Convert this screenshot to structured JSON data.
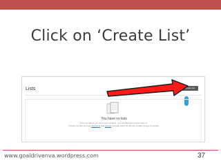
{
  "slide": {
    "title": "Click on ‘Create List’",
    "footer_url": "www.goaldrivenva.wordpress.com",
    "page_number": "37",
    "accent_color": "#c0504d"
  },
  "screenshot": {
    "heading": "Lists",
    "create_button_label": "Create List",
    "empty_state": {
      "title": "You have no lists",
      "line1": "Lists are where you store your contacts, you can filter/sort subset them in.",
      "line2_prefix": "Create one first and use",
      "line2_link1": "segments",
      "line2_mid": "and",
      "line2_link2": "groups",
      "line2_suffix": "to break down the list into smaller groups of people."
    },
    "icons": {
      "empty_state": "document-stack-icon",
      "pointer": "red-arrow-icon",
      "cursor": "blue-pointer-icon"
    }
  }
}
